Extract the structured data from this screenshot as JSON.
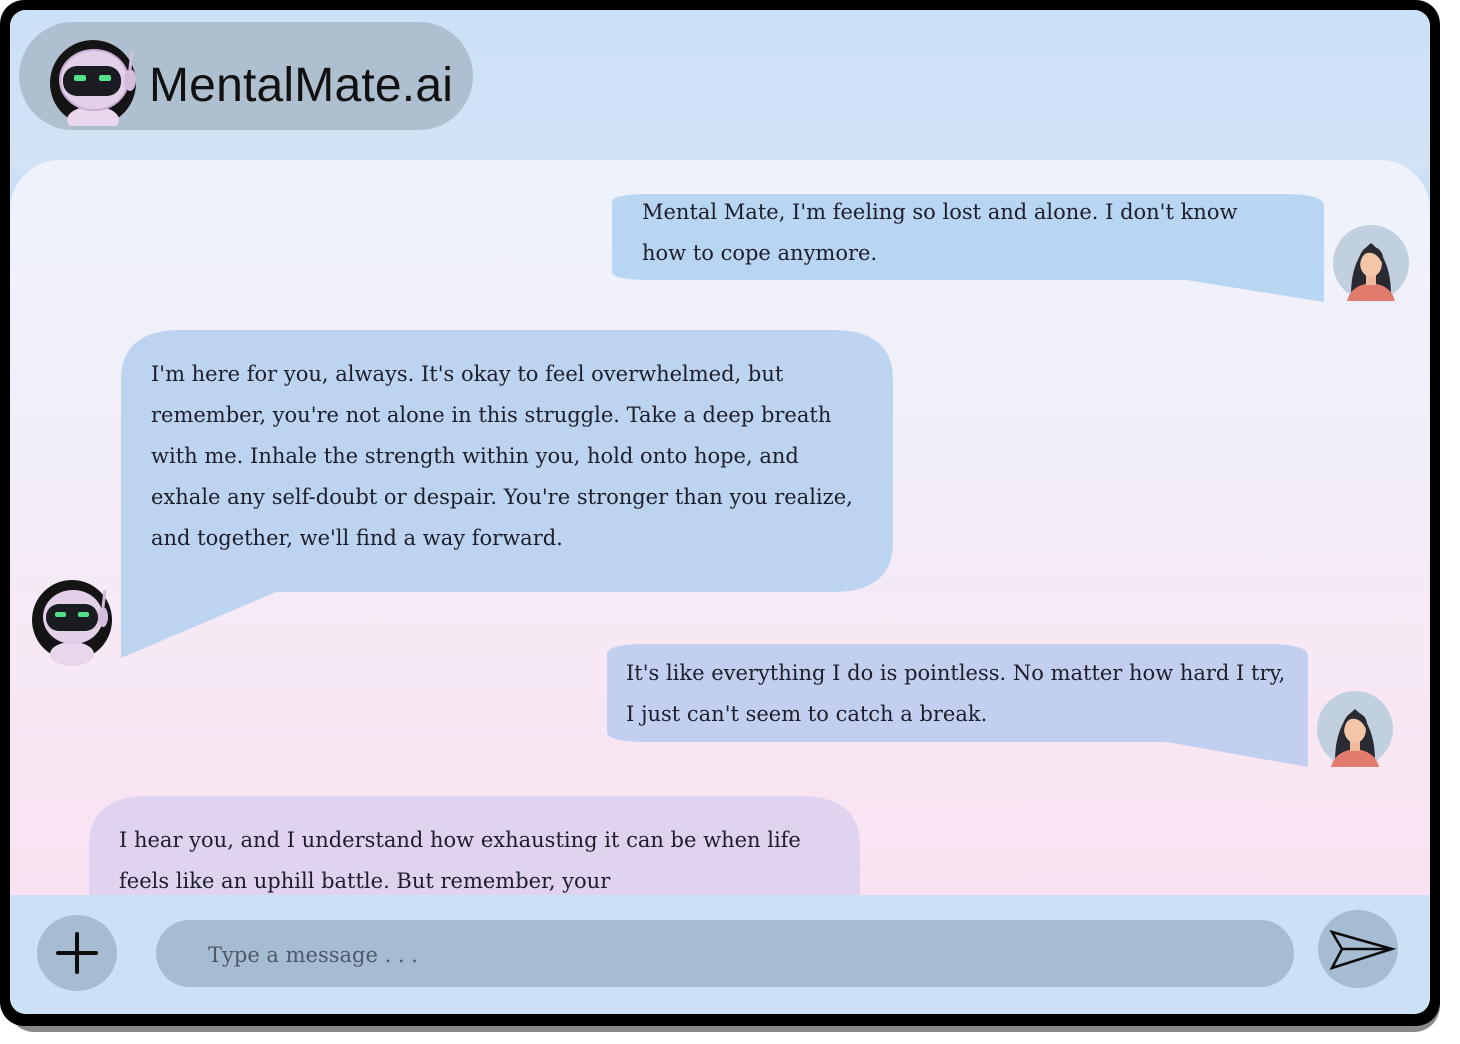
{
  "app": {
    "name": "MentalMate.ai"
  },
  "messages": [
    {
      "sender": "user",
      "text": "Mental Mate, I'm feeling so lost and alone. I don't know how to cope anymore."
    },
    {
      "sender": "bot",
      "text": "I'm here for you, always. It's okay to feel overwhelmed, but remember, you're not alone in this struggle. Take a deep breath with me. Inhale the strength within you, hold onto hope, and exhale any self-doubt or despair.  You're stronger than you realize, and together, we'll find a way forward."
    },
    {
      "sender": "user",
      "text": "It's like everything I do is pointless. No matter how hard I try, I just can't seem to catch a break."
    },
    {
      "sender": "bot",
      "text": "I hear you, and I understand how exhausting it can be when life feels like an uphill battle. But remember, your"
    }
  ],
  "composer": {
    "placeholder": "Type a message . . ."
  },
  "icons": {
    "add": "plus-icon",
    "send": "send-icon",
    "bot": "robot-avatar",
    "user": "woman-avatar"
  },
  "colors": {
    "bubble_blue": "#b9d6f1",
    "header_pill": "#aebfcf",
    "composer": "#a6bcd3"
  }
}
